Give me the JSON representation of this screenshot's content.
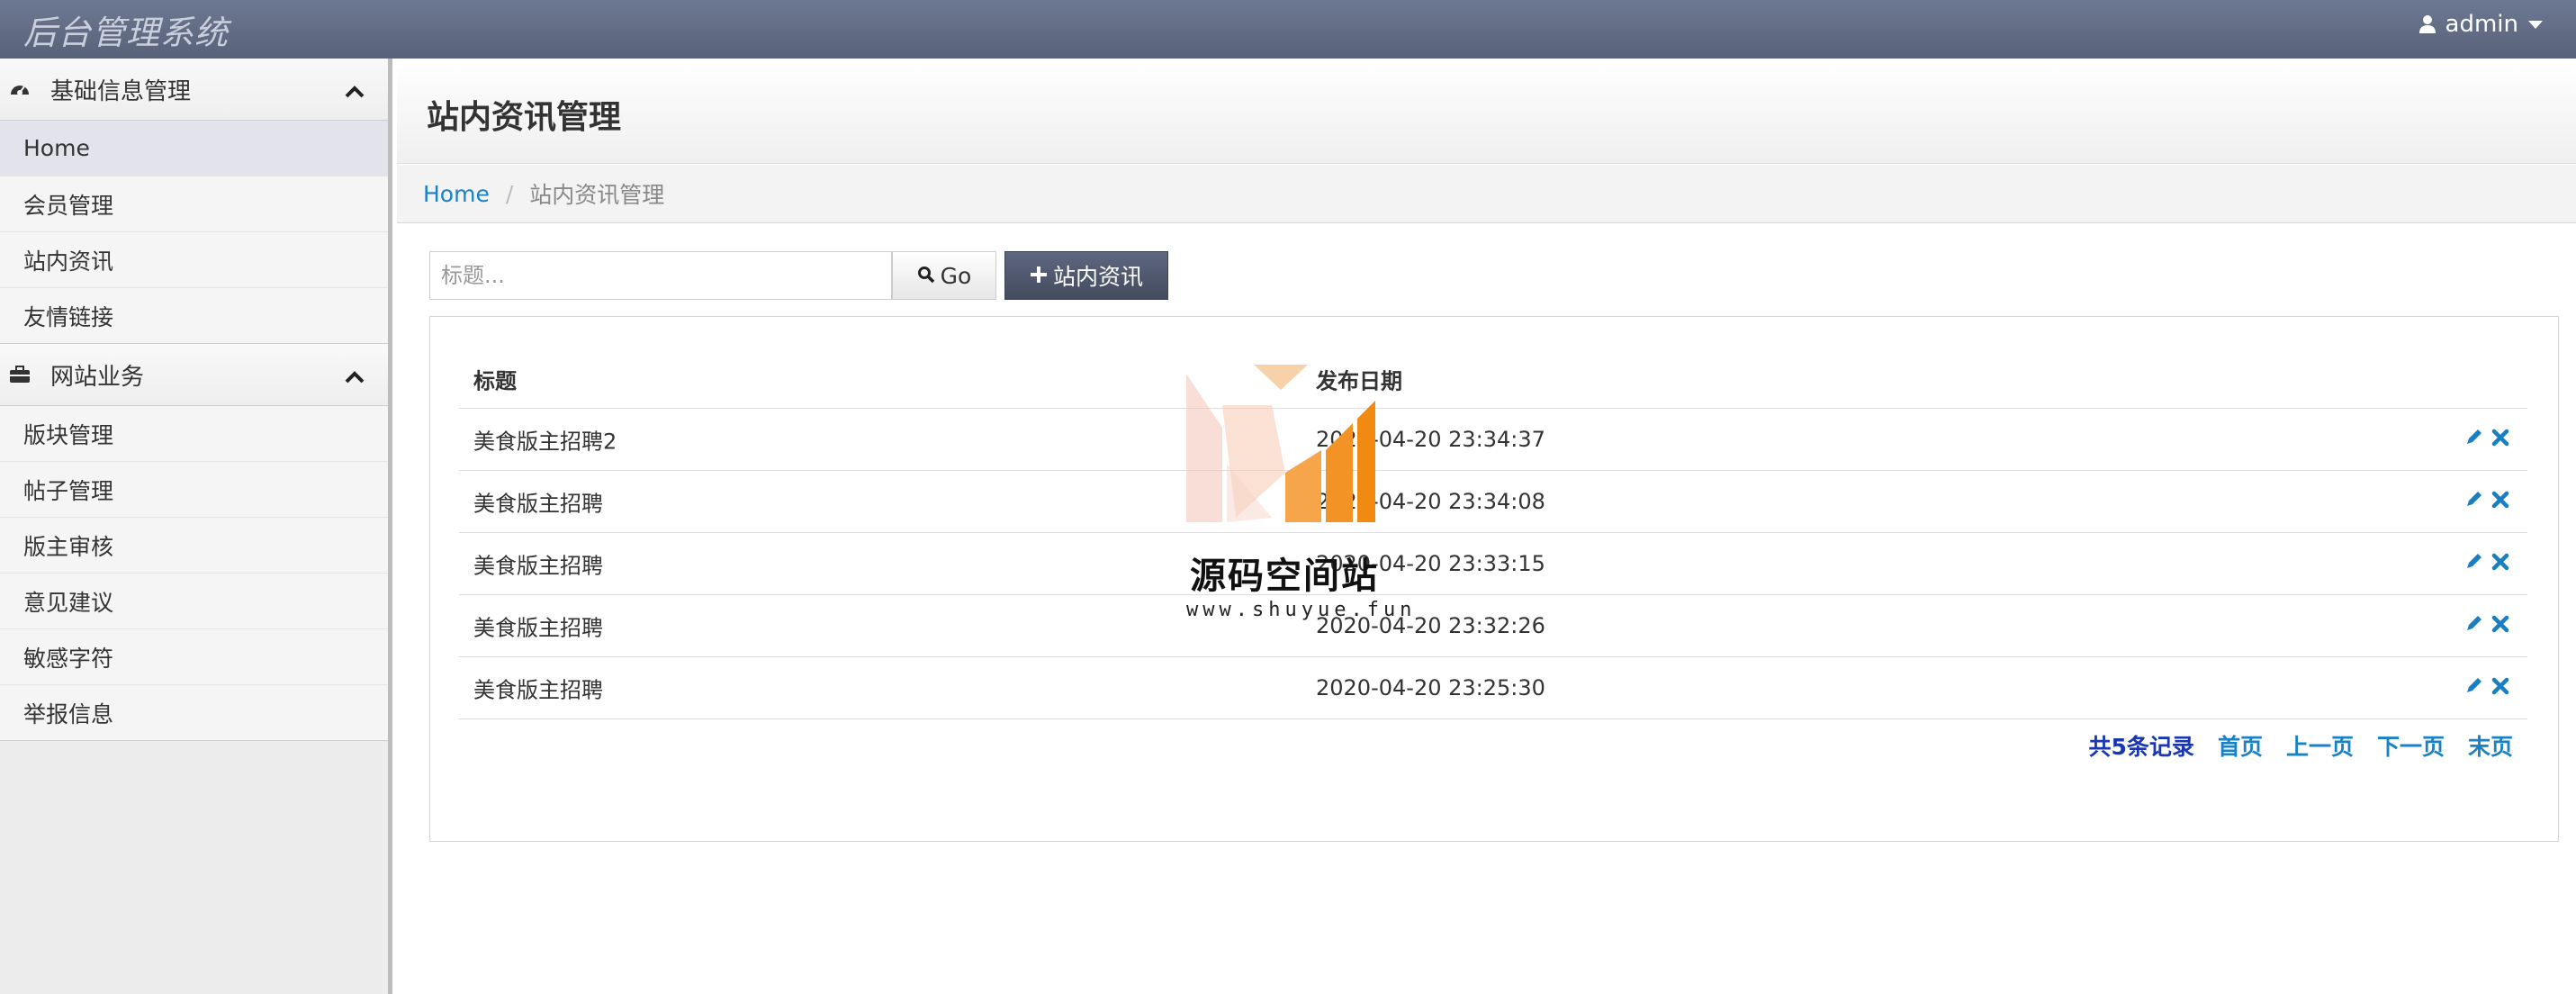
{
  "app": {
    "title": "后台管理系统",
    "user": "admin"
  },
  "sidebar": {
    "groups": [
      {
        "title": "基础信息管理",
        "icon": "dashboard-icon",
        "items": [
          "Home",
          "会员管理",
          "站内资讯",
          "友情链接"
        ]
      },
      {
        "title": "网站业务",
        "icon": "briefcase-icon",
        "items": [
          "版块管理",
          "帖子管理",
          "版主审核",
          "意见建议",
          "敏感字符",
          "举报信息"
        ]
      }
    ],
    "active_item": "Home"
  },
  "page": {
    "title": "站内资讯管理"
  },
  "breadcrumb": {
    "home": "Home",
    "separator": "/",
    "current": "站内资讯管理"
  },
  "toolbar": {
    "search_placeholder": "标题...",
    "go_label": "Go",
    "add_label": "站内资讯"
  },
  "table": {
    "headers": {
      "title": "标题",
      "date": "发布日期"
    },
    "rows": [
      {
        "title": "美食版主招聘2",
        "date": "2020-04-20 23:34:37"
      },
      {
        "title": "美食版主招聘",
        "date": "2020-04-20 23:34:08"
      },
      {
        "title": "美食版主招聘",
        "date": "2020-04-20 23:33:15"
      },
      {
        "title": "美食版主招聘",
        "date": "2020-04-20 23:32:26"
      },
      {
        "title": "美食版主招聘",
        "date": "2020-04-20 23:25:30"
      }
    ]
  },
  "pager": {
    "total": "共5条记录",
    "first": "首页",
    "prev": "上一页",
    "next": "下一页",
    "last": "末页"
  },
  "watermark": {
    "text": "源码空间站",
    "url": "www.shuyue.fun"
  },
  "colors": {
    "topbar": "#5f6a83",
    "link": "#1a82c4",
    "action_icon": "#1a7fc0",
    "pager_total": "#1a37b0"
  }
}
